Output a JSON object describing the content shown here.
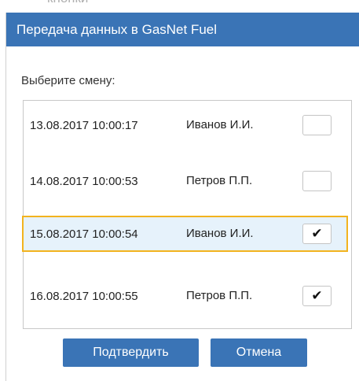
{
  "background": {
    "partial_text": "кнопки"
  },
  "dialog": {
    "title": "Передача данных в GasNet Fuel",
    "prompt": "Выберите смену:",
    "shifts": [
      {
        "date": "13.08.2017 10:00:17",
        "name": "Иванов И.И.",
        "checked": false,
        "check_mark": ""
      },
      {
        "date": "14.08.2017 10:00:53",
        "name": "Петров П.П.",
        "checked": false,
        "check_mark": ""
      },
      {
        "date": "15.08.2017 10:00:54",
        "name": "Иванов И.И.",
        "checked": true,
        "check_mark": "✔"
      },
      {
        "date": "16.08.2017 10:00:55",
        "name": "Петров П.П.",
        "checked": true,
        "check_mark": "✔"
      }
    ],
    "confirm_label": "Подтвердить",
    "cancel_label": "Отмена"
  },
  "colors": {
    "header": "#3a74b6",
    "selected_row_bg": "#e6f2fb",
    "selected_row_border": "#f2b31e"
  }
}
